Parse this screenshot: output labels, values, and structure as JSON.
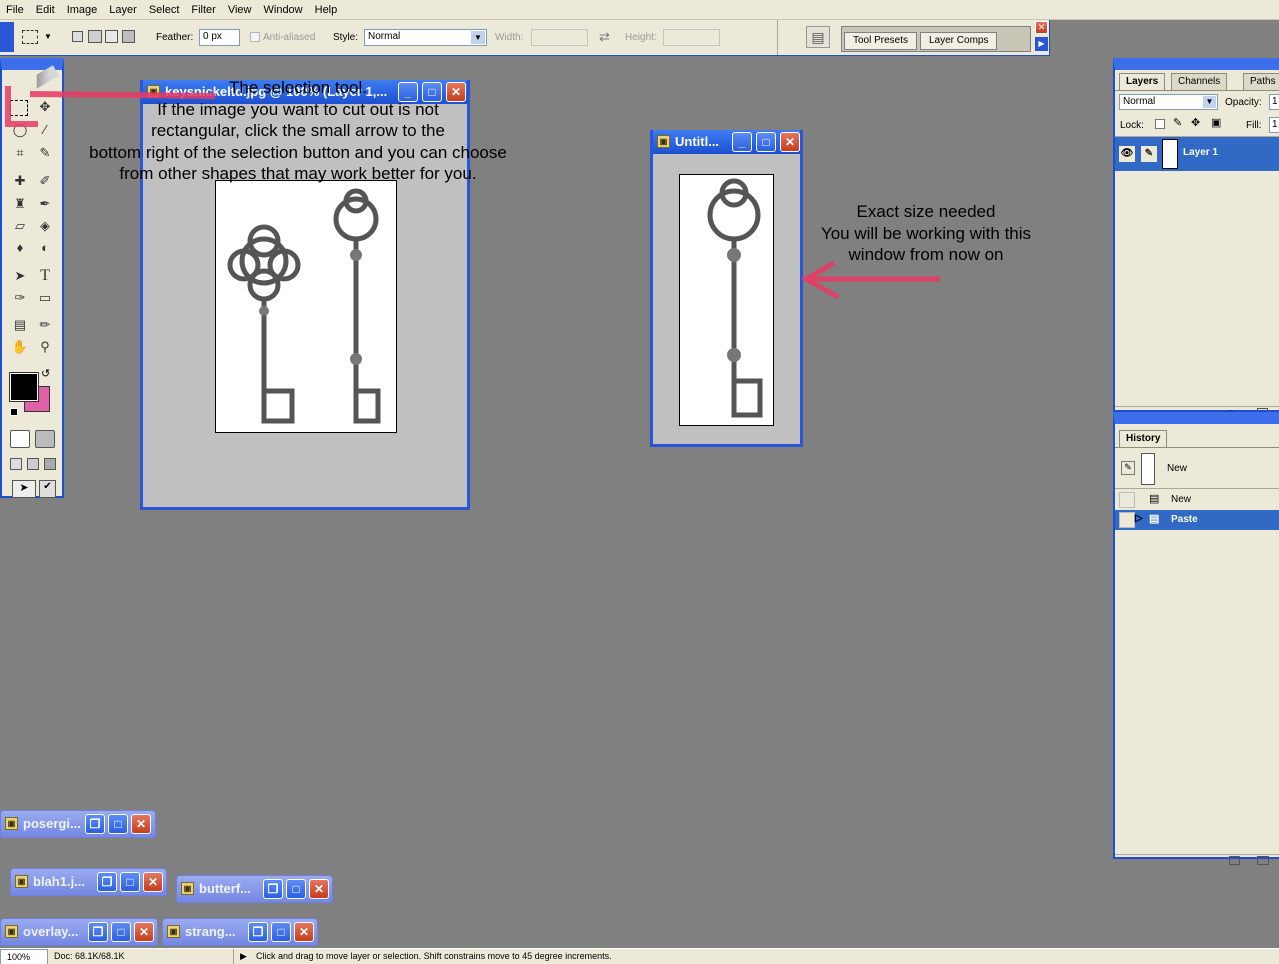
{
  "menu": [
    "File",
    "Edit",
    "Image",
    "Layer",
    "Select",
    "Filter",
    "View",
    "Window",
    "Help"
  ],
  "options": {
    "feather_label": "Feather:",
    "feather_value": "0 px",
    "antialias_label": "Anti-aliased",
    "style_label": "Style:",
    "style_value": "Normal",
    "width_label": "Width:",
    "height_label": "Height:",
    "tool_presets": "Tool Presets",
    "layer_comps": "Layer Comps"
  },
  "windows": {
    "keys": {
      "title": "keysnickeltd.jpg @ 100% (Layer 1,..."
    },
    "untitled": {
      "title": "Untitl..."
    }
  },
  "minimized": [
    "posergi...",
    "blah1.j...",
    "butterf...",
    "overlay...",
    "strang..."
  ],
  "annotations": {
    "selection_tool": [
      "The selection tool.",
      "If the image you want to cut out is not",
      "rectangular, click the small arrow to the",
      "bottom right of the selection button and you can choose",
      "from other shapes that may work better for you."
    ],
    "exact_size": [
      "Exact size needed",
      "You will be working with this",
      "window from now on"
    ]
  },
  "layers_panel": {
    "tabs": [
      "Layers",
      "Channels",
      "Paths"
    ],
    "blend_mode": "Normal",
    "opacity_label": "Opacity:",
    "opacity_value": "1",
    "lock_label": "Lock:",
    "fill_label": "Fill:",
    "fill_value": "1",
    "layer_name": "Layer 1"
  },
  "history_panel": {
    "tab": "History",
    "snapshot": "New",
    "items": [
      "New",
      "Paste"
    ]
  },
  "status": {
    "zoom": "100%",
    "doc": "Doc: 68.1K/68.1K",
    "hint": "Click and drag to move layer or selection. Shift constrains move to 45 degree increments."
  },
  "colors": {
    "accent": "#1d4fd0",
    "foreground": "#000000",
    "background": "#e060a8",
    "annotation_arrow": "#e83a64"
  }
}
